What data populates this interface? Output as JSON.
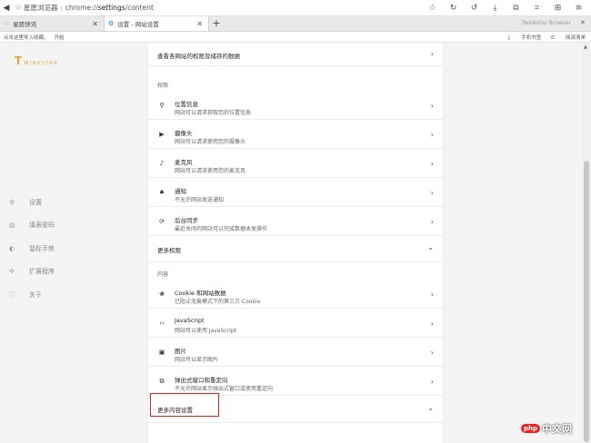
{
  "address_bar": {
    "brand": "星愿浏览器",
    "separator": "|",
    "url_prefix": "chrome://",
    "url_host": "settings",
    "url_path": "/content",
    "icons": [
      "star-icon",
      "refresh-icon",
      "history-icon",
      "download-icon",
      "screenshot-icon",
      "crop-icon",
      "extension-icon",
      "menu-icon"
    ]
  },
  "tabs": [
    {
      "label": "星愿快讯",
      "icon": "star-icon"
    },
    {
      "label": "设置 - 网站设置",
      "icon": "gear-icon"
    }
  ],
  "tab_close": "✕",
  "new_tab": "+",
  "account": "Twinkstar Browser",
  "bookmarks_bar": {
    "hint": "点击这里导入收藏。",
    "hint_action": "开始",
    "right_items": [
      "手机书签",
      "阅读清单"
    ]
  },
  "sidebar": {
    "logo_text": "WINKSTAR",
    "items": [
      {
        "label": "设置",
        "icon": "gear-icon"
      },
      {
        "label": "填表密码",
        "icon": "form-icon"
      },
      {
        "label": "鼠标手势",
        "icon": "mouse-icon"
      },
      {
        "label": "扩展程序",
        "icon": "puzzle-icon"
      },
      {
        "label": "关于",
        "icon": "info-icon"
      }
    ]
  },
  "content": {
    "top_row": "查看各网站的权限及储存的数据",
    "permissions_header": "权限",
    "permissions": [
      {
        "title": "位置信息",
        "subtitle": "网站可以请求获取您的位置信息",
        "icon": "location-icon"
      },
      {
        "title": "摄像头",
        "subtitle": "网站可以请求使用您的摄像头",
        "icon": "camera-icon"
      },
      {
        "title": "麦克风",
        "subtitle": "网站可以请求使用您的麦克风",
        "icon": "microphone-icon"
      },
      {
        "title": "通知",
        "subtitle": "不允许网站发送通知",
        "icon": "bell-icon"
      },
      {
        "title": "后台同步",
        "subtitle": "最近关闭的网站可以完成数据收发操作",
        "icon": "sync-icon"
      }
    ],
    "more_permissions": "更多权限",
    "content_header": "内容",
    "content_items": [
      {
        "title": "Cookie 和网站数据",
        "subtitle": "已阻止无痕模式下的第三方 Cookie",
        "icon": "cookie-icon"
      },
      {
        "title": "JavaScript",
        "subtitle": "网站可以使用 JavaScript",
        "icon": "code-icon"
      },
      {
        "title": "图片",
        "subtitle": "网站可以显示图片",
        "icon": "image-icon"
      },
      {
        "title": "弹出式窗口和重定向",
        "subtitle": "不允许网站显示弹出式窗口或使用重定向",
        "icon": "popup-icon"
      }
    ],
    "more_content": "更多内容设置"
  },
  "watermark": {
    "badge": "php",
    "text": "中文网"
  }
}
